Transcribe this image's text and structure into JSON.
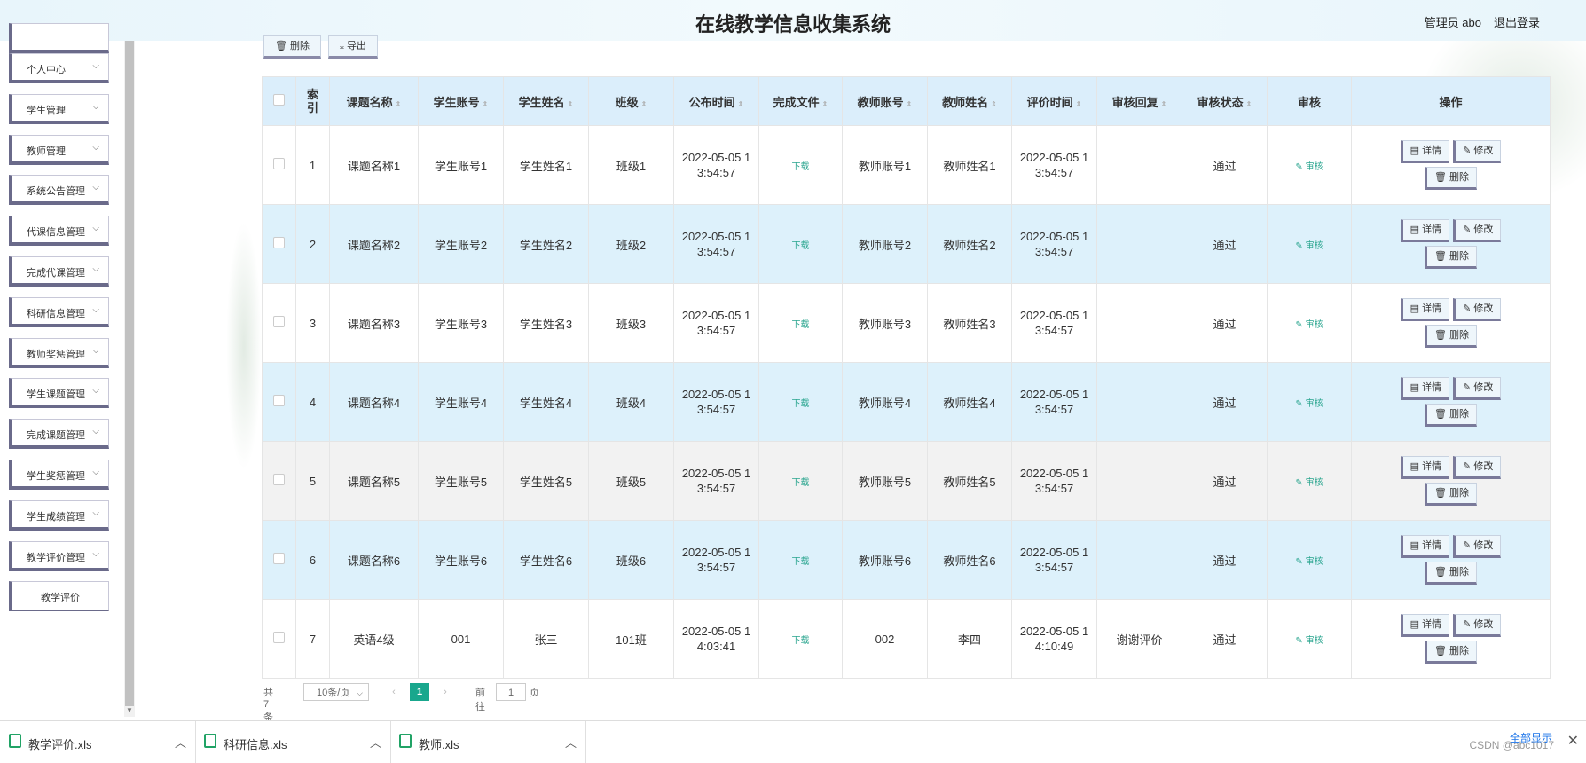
{
  "header": {
    "title": "在线教学信息收集系统",
    "user": "管理员 abo",
    "logout": "退出登录"
  },
  "sidebar": {
    "items": [
      {
        "label": "个人中心"
      },
      {
        "label": "学生管理"
      },
      {
        "label": "教师管理"
      },
      {
        "label": "系统公告管理"
      },
      {
        "label": "代课信息管理"
      },
      {
        "label": "完成代课管理"
      },
      {
        "label": "科研信息管理"
      },
      {
        "label": "教师奖惩管理"
      },
      {
        "label": "学生课题管理"
      },
      {
        "label": "完成课题管理"
      },
      {
        "label": "学生奖惩管理"
      },
      {
        "label": "学生成绩管理"
      },
      {
        "label": "教学评价管理"
      }
    ],
    "sub_item": "教学评价"
  },
  "toolbar": {
    "delete_label": "删除",
    "export_label": "导出"
  },
  "table": {
    "columns": [
      "索引",
      "课题名称",
      "学生账号",
      "学生姓名",
      "班级",
      "公布时间",
      "完成文件",
      "教师账号",
      "教师姓名",
      "评价时间",
      "审核回复",
      "审核状态",
      "审核",
      "操作"
    ],
    "download_label": "下载",
    "audit_label": "审核",
    "detail_label": "详情",
    "edit_label": "修改",
    "remove_label": "删除",
    "rows": [
      {
        "idx": "1",
        "topic": "课题名称1",
        "stu_acc": "学生账号1",
        "stu_name": "学生姓名1",
        "cls": "班级1",
        "pub1": "2022-05-05 1",
        "pub2": "3:54:57",
        "tch_acc": "教师账号1",
        "tch_name": "教师姓名1",
        "ev1": "2022-05-05 1",
        "ev2": "3:54:57",
        "reply": "",
        "status": "通过"
      },
      {
        "idx": "2",
        "topic": "课题名称2",
        "stu_acc": "学生账号2",
        "stu_name": "学生姓名2",
        "cls": "班级2",
        "pub1": "2022-05-05 1",
        "pub2": "3:54:57",
        "tch_acc": "教师账号2",
        "tch_name": "教师姓名2",
        "ev1": "2022-05-05 1",
        "ev2": "3:54:57",
        "reply": "",
        "status": "通过"
      },
      {
        "idx": "3",
        "topic": "课题名称3",
        "stu_acc": "学生账号3",
        "stu_name": "学生姓名3",
        "cls": "班级3",
        "pub1": "2022-05-05 1",
        "pub2": "3:54:57",
        "tch_acc": "教师账号3",
        "tch_name": "教师姓名3",
        "ev1": "2022-05-05 1",
        "ev2": "3:54:57",
        "reply": "",
        "status": "通过"
      },
      {
        "idx": "4",
        "topic": "课题名称4",
        "stu_acc": "学生账号4",
        "stu_name": "学生姓名4",
        "cls": "班级4",
        "pub1": "2022-05-05 1",
        "pub2": "3:54:57",
        "tch_acc": "教师账号4",
        "tch_name": "教师姓名4",
        "ev1": "2022-05-05 1",
        "ev2": "3:54:57",
        "reply": "",
        "status": "通过"
      },
      {
        "idx": "5",
        "topic": "课题名称5",
        "stu_acc": "学生账号5",
        "stu_name": "学生姓名5",
        "cls": "班级5",
        "pub1": "2022-05-05 1",
        "pub2": "3:54:57",
        "tch_acc": "教师账号5",
        "tch_name": "教师姓名5",
        "ev1": "2022-05-05 1",
        "ev2": "3:54:57",
        "reply": "",
        "status": "通过"
      },
      {
        "idx": "6",
        "topic": "课题名称6",
        "stu_acc": "学生账号6",
        "stu_name": "学生姓名6",
        "cls": "班级6",
        "pub1": "2022-05-05 1",
        "pub2": "3:54:57",
        "tch_acc": "教师账号6",
        "tch_name": "教师姓名6",
        "ev1": "2022-05-05 1",
        "ev2": "3:54:57",
        "reply": "",
        "status": "通过"
      },
      {
        "idx": "7",
        "topic": "英语4级",
        "stu_acc": "001",
        "stu_name": "张三",
        "cls": "101班",
        "pub1": "2022-05-05 1",
        "pub2": "4:03:41",
        "tch_acc": "002",
        "tch_name": "李四",
        "ev1": "2022-05-05 1",
        "ev2": "4:10:49",
        "reply": "谢谢评价",
        "status": "通过"
      }
    ]
  },
  "pager": {
    "total": "共 7 条",
    "page_size": "10条/页",
    "current_page": "1",
    "goto_prefix": "前往",
    "goto_value": "1",
    "goto_suffix": "页"
  },
  "downloads": {
    "files": [
      "教学评价.xls",
      "科研信息.xls",
      "教师.xls"
    ],
    "show_all": "全部显示",
    "watermark": "CSDN @abc1017"
  }
}
